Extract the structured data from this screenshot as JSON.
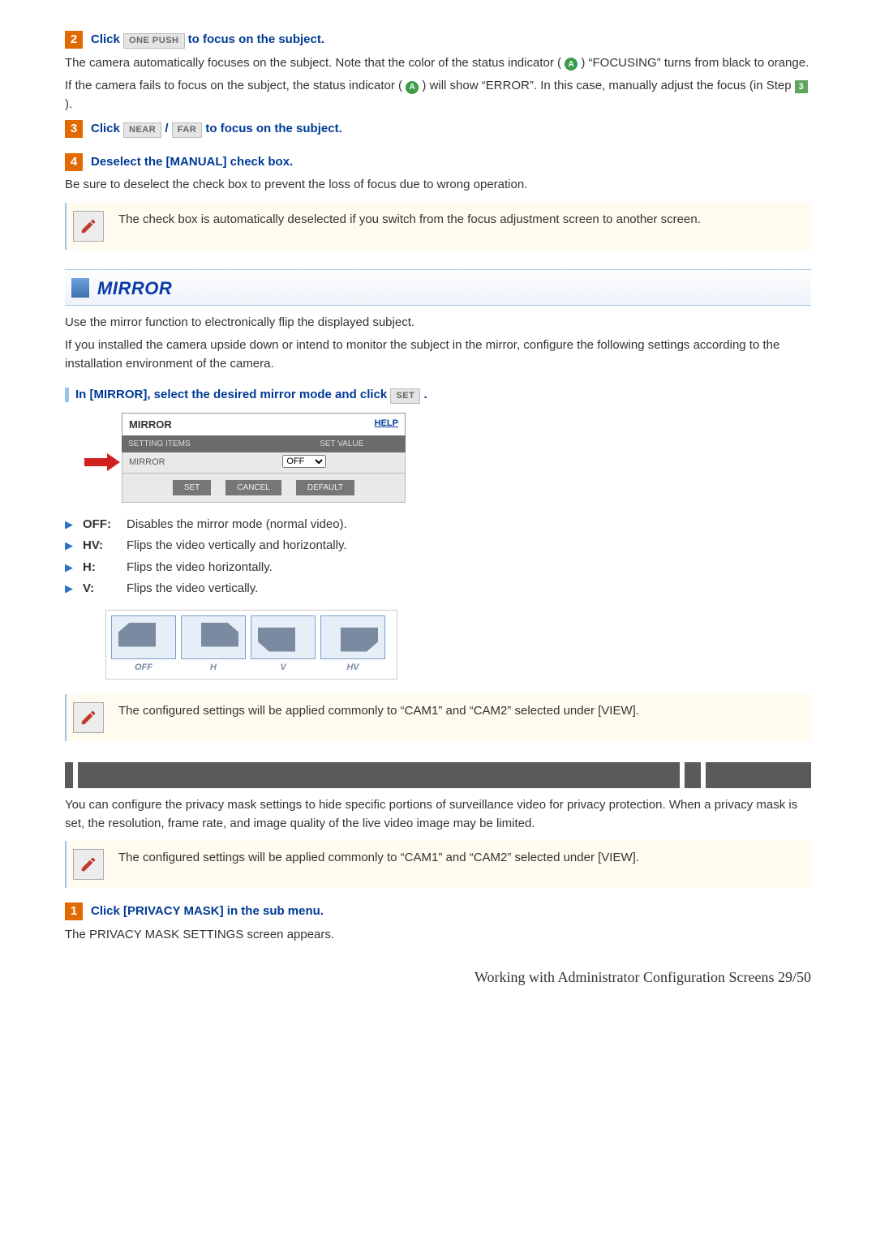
{
  "step2": {
    "num": "2",
    "title_pre": "Click ",
    "btn": "ONE PUSH",
    "title_post": " to focus on the subject.",
    "p1a": "The camera automatically focuses on the subject. Note that the color of the status indicator (",
    "badge": "A",
    "p1b": ") “FOCUSING” turns from black to orange.",
    "p2a": "If the camera fails to focus on the subject, the status indicator (",
    "p2b": ") will show “ERROR”. In this case, manually adjust the focus (in Step ",
    "step_ref": "3",
    "p2c": ")."
  },
  "step3": {
    "num": "3",
    "title_pre": "Click ",
    "btn1": "NEAR",
    "sep": " / ",
    "btn2": "FAR",
    "title_post": " to focus on the subject."
  },
  "step4": {
    "num": "4",
    "title": "Deselect the [MANUAL] check box.",
    "body": "Be sure to deselect the check box to prevent the loss of focus due to wrong operation.",
    "note": "The check box is automatically deselected if you switch from the focus adjustment screen to another screen."
  },
  "mirror": {
    "heading": "MIRROR",
    "intro1": "Use the mirror function to electronically flip the displayed subject.",
    "intro2": "If you installed the camera upside down or intend to monitor the subject in the mirror, configure the following settings according to the installation environment of the camera.",
    "subh_pre": "In [MIRROR], select the desired mirror mode and click ",
    "subh_btn": "SET",
    "subh_post": ".",
    "panel": {
      "title": "MIRROR",
      "help": "HELP",
      "col1": "SETTING ITEMS",
      "col2": "SET VALUE",
      "row_label": "MIRROR",
      "row_value": "OFF",
      "btn_set": "SET",
      "btn_cancel": "CANCEL",
      "btn_default": "DEFAULT"
    },
    "options": [
      {
        "label": "OFF:",
        "desc": "Disables the mirror mode (normal video)."
      },
      {
        "label": "HV:",
        "desc": "Flips the video vertically and horizontally."
      },
      {
        "label": "H:",
        "desc": "Flips the video horizontally."
      },
      {
        "label": "V:",
        "desc": "Flips the video vertically."
      }
    ],
    "thumbs": [
      "OFF",
      "H",
      "V",
      "HV"
    ],
    "note": "The configured settings will be applied commonly to “CAM1” and “CAM2” selected under [VIEW]."
  },
  "privacy": {
    "p1": "You can configure the privacy mask settings to hide specific portions of surveillance video for privacy protection. When a privacy mask is set, the resolution, frame rate, and image quality of the live video image may be limited.",
    "note": "The configured settings will be applied commonly to “CAM1” and “CAM2” selected under [VIEW].",
    "step_num": "1",
    "step_title": "Click [PRIVACY MASK] in the sub menu.",
    "step_body": "The PRIVACY MASK SETTINGS screen appears."
  },
  "footer": "Working with Administrator Configuration Screens 29/50"
}
